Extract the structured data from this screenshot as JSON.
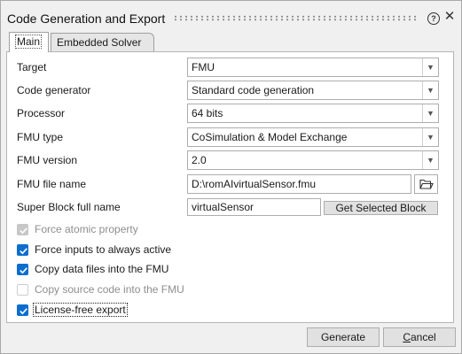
{
  "window": {
    "title": "Code Generation and Export",
    "help_glyph": "?",
    "close_glyph": "✕"
  },
  "tabs": [
    {
      "label": "Main",
      "selected": true
    },
    {
      "label": "Embedded Solver",
      "selected": false
    }
  ],
  "form": {
    "target": {
      "label": "Target",
      "value": "FMU"
    },
    "code_generator": {
      "label": "Code generator",
      "value": "Standard code generation"
    },
    "processor": {
      "label": "Processor",
      "value": "64 bits"
    },
    "fmu_type": {
      "label": "FMU type",
      "value": "CoSimulation & Model Exchange"
    },
    "fmu_version": {
      "label": "FMU version",
      "value": "2.0"
    },
    "fmu_file_name": {
      "label": "FMU file name",
      "value": "D:\\romAIvirtualSensor.fmu",
      "browse_icon": "folder-icon"
    },
    "super_block": {
      "label": "Super Block full name",
      "value": "virtualSensor",
      "button_label": "Get Selected Block"
    }
  },
  "checkboxes": [
    {
      "label": "Force atomic property",
      "checked": true,
      "disabled": true
    },
    {
      "label": "Force inputs to always active",
      "checked": true,
      "disabled": false
    },
    {
      "label": "Copy data files into the FMU",
      "checked": true,
      "disabled": false
    },
    {
      "label": "Copy source code into the FMU",
      "checked": false,
      "disabled": true
    },
    {
      "label": "License-free export",
      "checked": true,
      "disabled": false
    }
  ],
  "footer": {
    "generate_label": "Generate",
    "cancel_label": "Cancel",
    "cancel_mnemonic": "C",
    "cancel_rest": "ancel"
  },
  "colors": {
    "accent": "#0b6ece",
    "disabled_check": "#c7c7c7"
  }
}
